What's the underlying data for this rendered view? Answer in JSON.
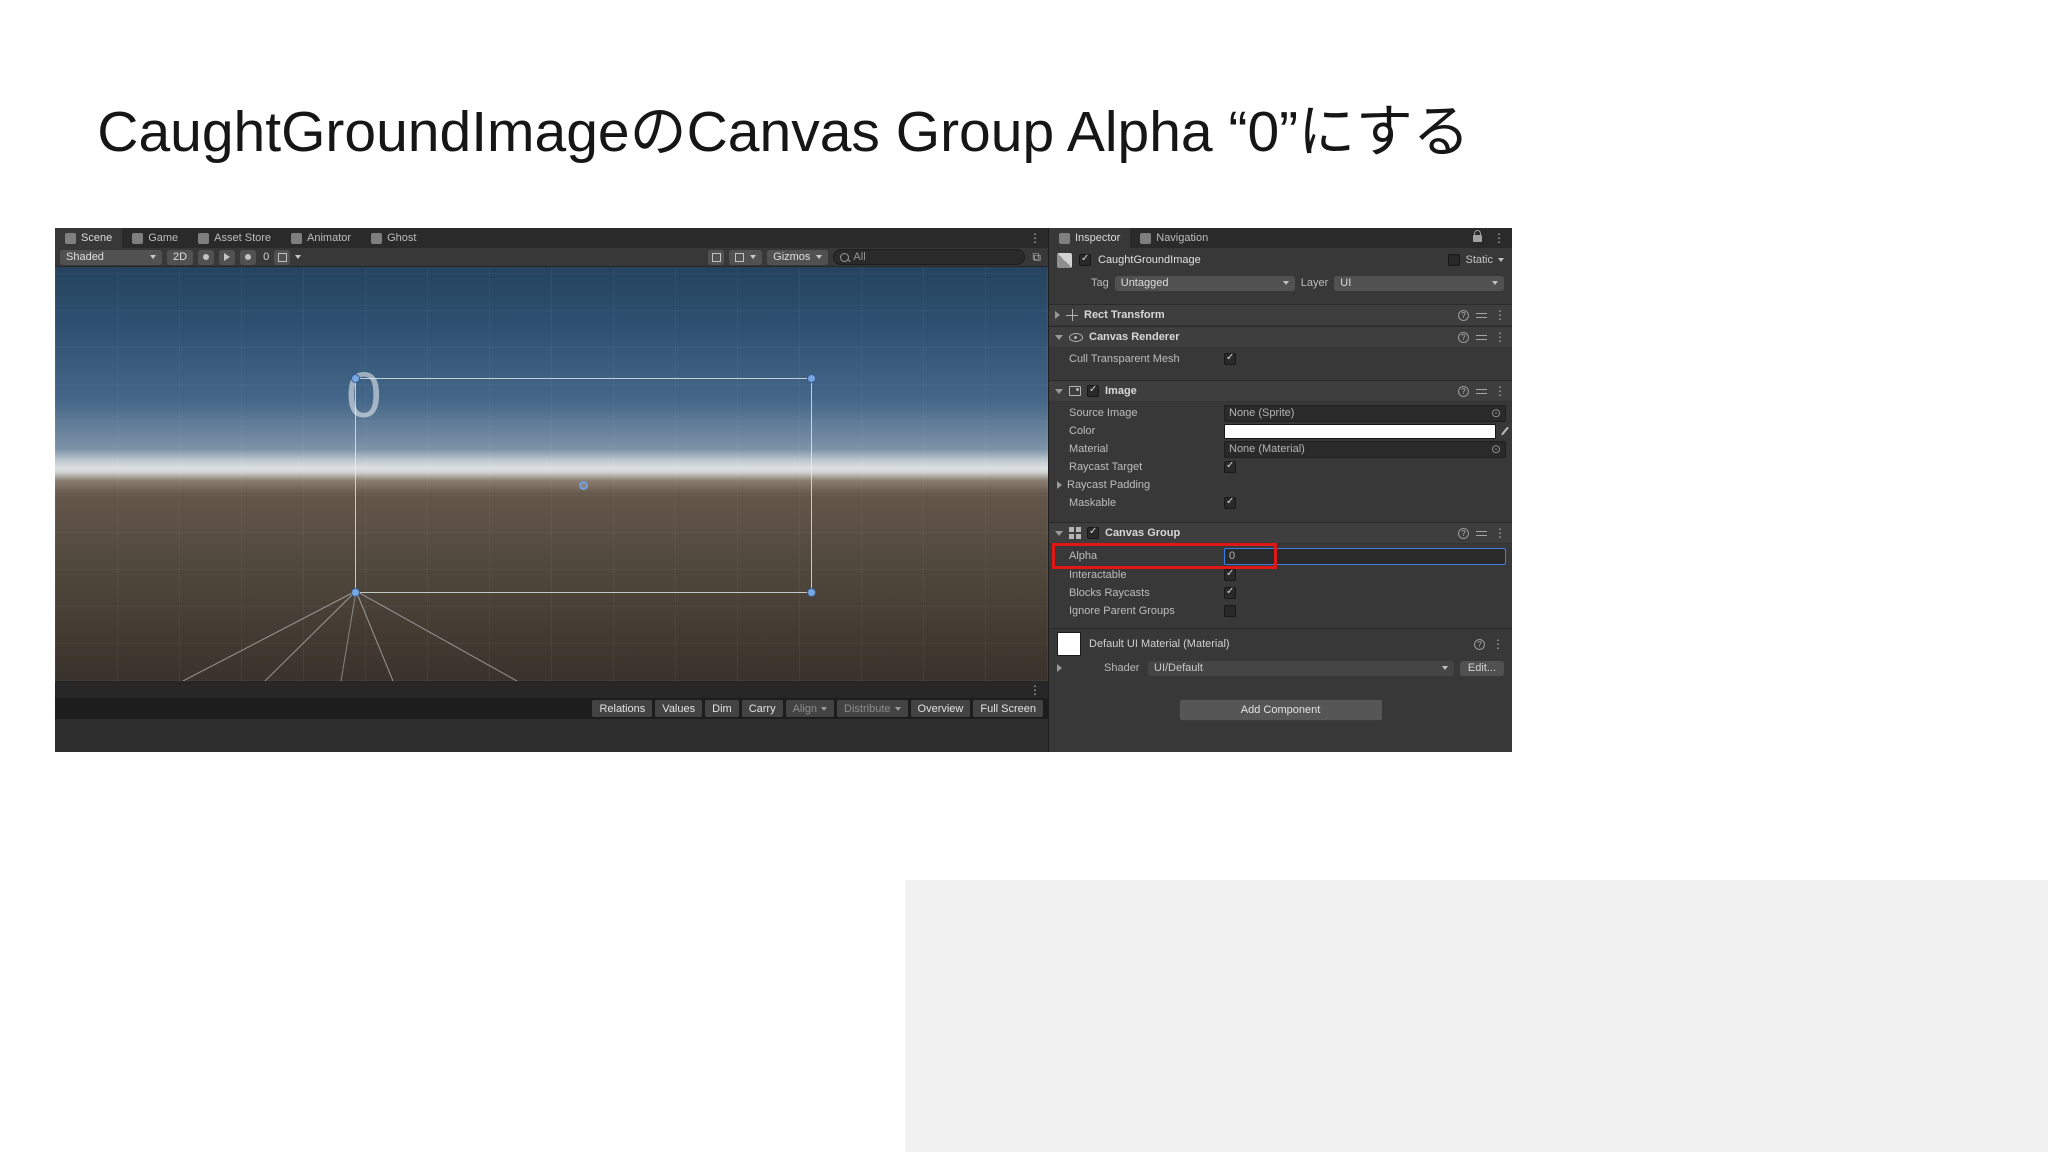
{
  "slide": {
    "title": "CaughtGroundImageのCanvas Group Alpha “0”にする"
  },
  "editor": {
    "tabs": [
      {
        "label": "Scene"
      },
      {
        "label": "Game"
      },
      {
        "label": "Asset Store"
      },
      {
        "label": "Animator"
      },
      {
        "label": "Ghost"
      }
    ],
    "toolbar": {
      "shaded": "Shaded",
      "mode_2d": "2D",
      "effects_count": "0",
      "gizmos": "Gizmos",
      "search_value": "All"
    },
    "scene": {
      "overlay_zero": "0"
    },
    "bottom_bar": {
      "buttons": [
        {
          "label": "Relations",
          "enabled": true
        },
        {
          "label": "Values",
          "enabled": true
        },
        {
          "label": "Dim",
          "enabled": true
        },
        {
          "label": "Carry",
          "enabled": true
        },
        {
          "label": "Align",
          "enabled": false,
          "dropdown": true
        },
        {
          "label": "Distribute",
          "enabled": false,
          "dropdown": true
        },
        {
          "label": "Overview",
          "enabled": true
        },
        {
          "label": "Full Screen",
          "enabled": true
        }
      ]
    }
  },
  "inspector": {
    "tabs": [
      {
        "label": "Inspector"
      },
      {
        "label": "Navigation"
      }
    ],
    "header": {
      "name": "CaughtGroundImage",
      "name_checked": true,
      "static_label": "Static",
      "static_checked": false,
      "tag_label": "Tag",
      "tag_value": "Untagged",
      "layer_label": "Layer",
      "layer_value": "UI"
    },
    "components": {
      "rect_transform": {
        "title": "Rect Transform"
      },
      "canvas_renderer": {
        "title": "Canvas Renderer",
        "cull_label": "Cull Transparent Mesh",
        "cull_checked": true
      },
      "image": {
        "title": "Image",
        "enabled": true,
        "rows": {
          "source_image_label": "Source Image",
          "source_image_value": "None (Sprite)",
          "color_label": "Color",
          "color_value_hex": "#ffffff",
          "material_label": "Material",
          "material_value": "None (Material)",
          "raycast_target_label": "Raycast Target",
          "raycast_target_checked": true,
          "raycast_padding_label": "Raycast Padding",
          "maskable_label": "Maskable",
          "maskable_checked": true
        }
      },
      "canvas_group": {
        "title": "Canvas Group",
        "enabled": true,
        "alpha_label": "Alpha",
        "alpha_value": "0",
        "alpha_highlighted": true,
        "interactable_label": "Interactable",
        "interactable_checked": true,
        "blocks_raycasts_label": "Blocks Raycasts",
        "blocks_raycasts_checked": true,
        "ignore_parent_groups_label": "Ignore Parent Groups",
        "ignore_parent_groups_checked": false
      }
    },
    "material_section": {
      "title": "Default UI Material (Material)",
      "shader_label": "Shader",
      "shader_value": "UI/Default",
      "edit_button": "Edit..."
    },
    "add_component": "Add Component"
  },
  "colors": {
    "annotation_red": "#e01717",
    "focus_blue": "#3e7de7",
    "panel_bg": "#383838",
    "field_bg": "#2a2a2a"
  }
}
